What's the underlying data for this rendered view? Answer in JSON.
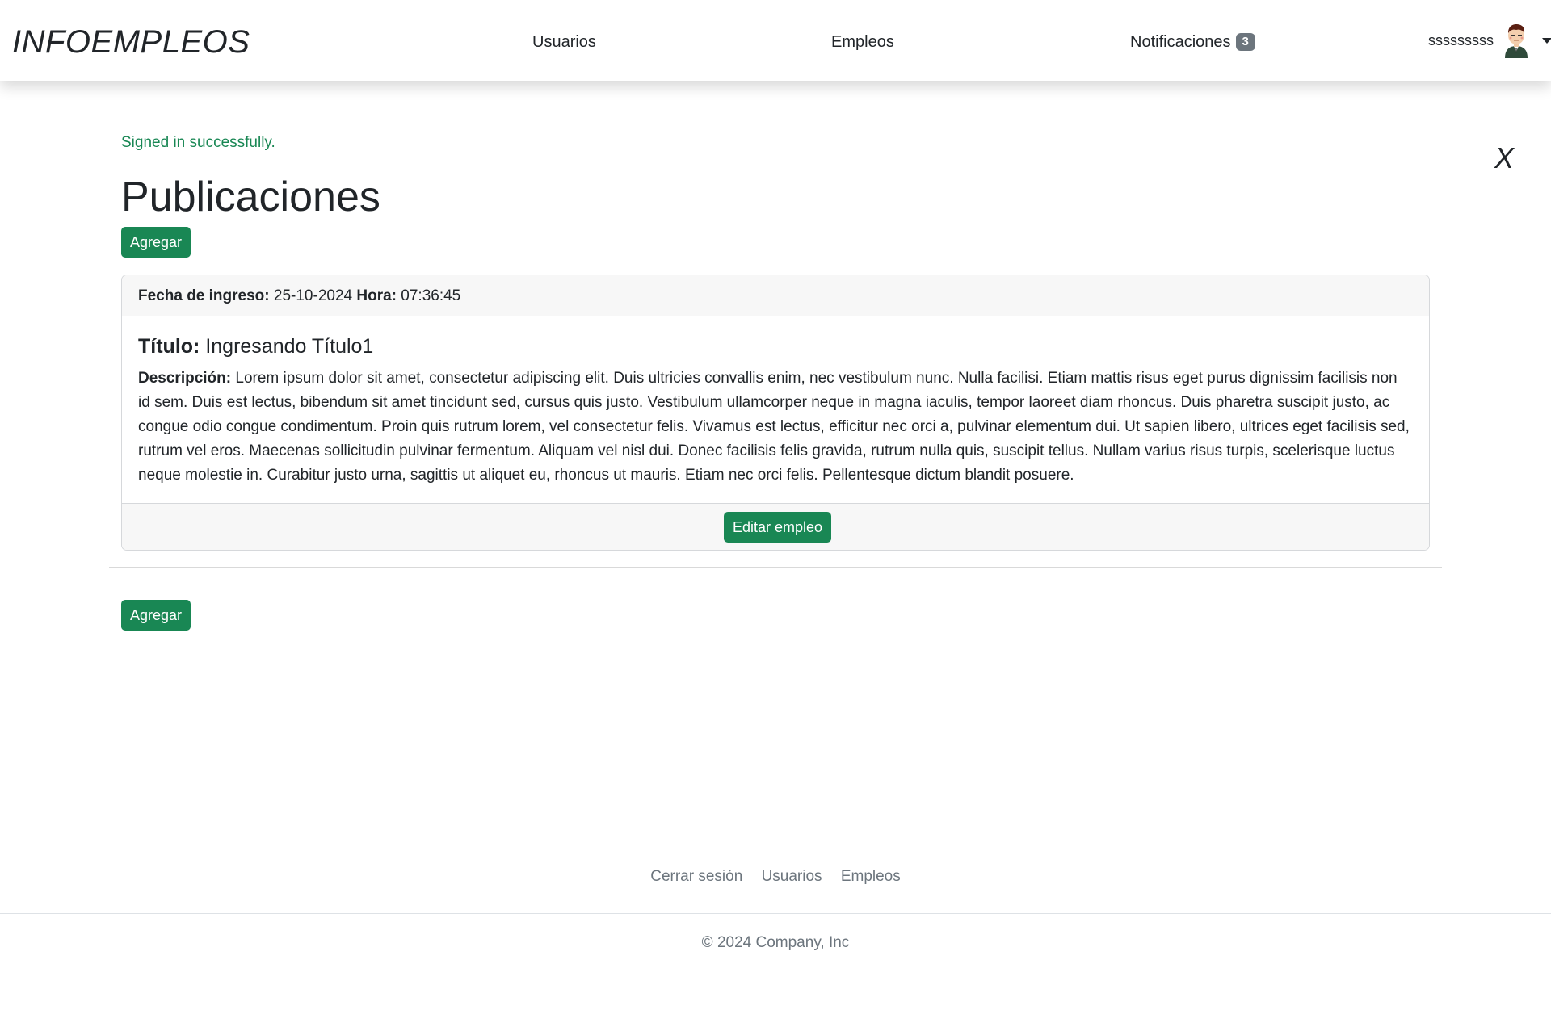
{
  "navbar": {
    "brand": "INFOEMPLEOS",
    "links": {
      "usuarios": "Usuarios",
      "empleos": "Empleos",
      "notificaciones": "Notificaciones"
    },
    "notification_count": "3",
    "username": "sssssssss",
    "avatar_icon": "user-avatar-icon",
    "dropdown_icon": "caret-down-icon"
  },
  "flash": {
    "message": "Signed in successfully.",
    "close_label": "X"
  },
  "main": {
    "title": "Publicaciones",
    "add_button": "Agregar"
  },
  "post": {
    "date_label": "Fecha de ingreso:",
    "date_value": "25-10-2024",
    "time_label": "Hora:",
    "time_value": "07:36:45",
    "title_label": "Título:",
    "title_value": "Ingresando Título1",
    "description_label": "Descripción:",
    "description_value": "Lorem ipsum dolor sit amet, consectetur adipiscing elit. Duis ultricies convallis enim, nec vestibulum nunc. Nulla facilisi. Etiam mattis risus eget purus dignissim facilisis non id sem. Duis est lectus, bibendum sit amet tincidunt sed, cursus quis justo. Vestibulum ullamcorper neque in magna iaculis, tempor laoreet diam rhoncus. Duis pharetra suscipit justo, ac congue odio congue condimentum. Proin quis rutrum lorem, vel consectetur felis. Vivamus est lectus, efficitur nec orci a, pulvinar elementum dui. Ut sapien libero, ultrices eget facilisis sed, rutrum vel eros. Maecenas sollicitudin pulvinar fermentum. Aliquam vel nisl dui. Donec facilisis felis gravida, rutrum nulla quis, suscipit tellus. Nullam varius risus turpis, scelerisque luctus neque molestie in. Curabitur justo urna, sagittis ut aliquet eu, rhoncus ut mauris. Etiam nec orci felis. Pellentesque dictum blandit posuere.",
    "edit_button": "Editar empleo"
  },
  "footer": {
    "links": {
      "logout": "Cerrar sesión",
      "usuarios": "Usuarios",
      "empleos": "Empleos"
    },
    "copyright": "© 2024 Company, Inc"
  },
  "colors": {
    "success": "#198754",
    "flash_text": "#198754",
    "badge": "#6c757d",
    "muted_text": "#6c757d",
    "card_header_bg": "#f7f7f7"
  }
}
